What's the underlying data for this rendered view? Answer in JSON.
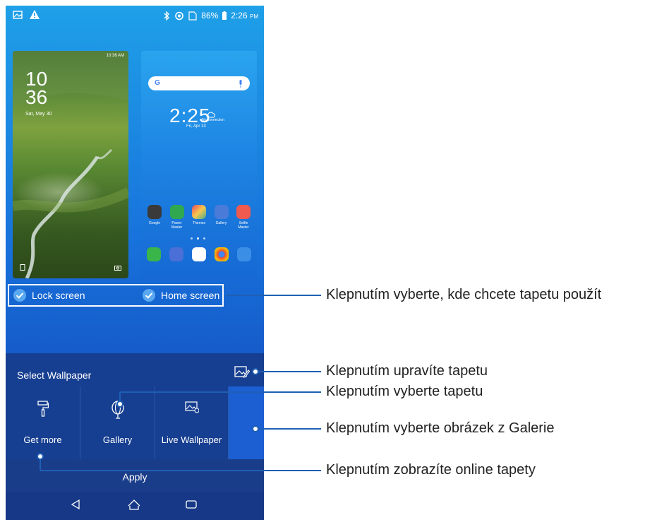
{
  "status_bar": {
    "battery": "86%",
    "time": "2:26",
    "ampm": "PM"
  },
  "lock_preview": {
    "status_time": "10:36 AM",
    "hour": "10",
    "minute": "36",
    "date": "Sat, May 30"
  },
  "home_preview": {
    "clock": "2:25",
    "weather": "No connection",
    "date": "Fri, Apr 13",
    "apps": [
      {
        "label": "Google",
        "color": "#3a3a3a"
      },
      {
        "label": "Power Master",
        "color": "#2fa84f"
      },
      {
        "label": "Themes",
        "color": "#e84a5f"
      },
      {
        "label": "Gallery",
        "color": "#4a7bd8"
      },
      {
        "label": "Selfie Master",
        "color": "#f05a4f"
      }
    ],
    "dock": [
      "#39b54a",
      "#4a6fd6",
      "#ffffff",
      "#ea4335",
      "#3a8ee6"
    ]
  },
  "targets": {
    "lock_screen": "Lock screen",
    "home_screen": "Home screen"
  },
  "panel": {
    "title": "Select Wallpaper",
    "tiles": [
      {
        "label": "Get more"
      },
      {
        "label": "Gallery"
      },
      {
        "label": "Live Wallpaper"
      }
    ],
    "apply": "Apply"
  },
  "callouts": [
    "Klepnutím vyberte, kde chcete tapetu použít",
    "Klepnutím upravíte tapetu",
    "Klepnutím vyberte tapetu",
    "Klepnutím vyberte obrázek z Galerie",
    "Klepnutím zobrazíte online tapety"
  ]
}
